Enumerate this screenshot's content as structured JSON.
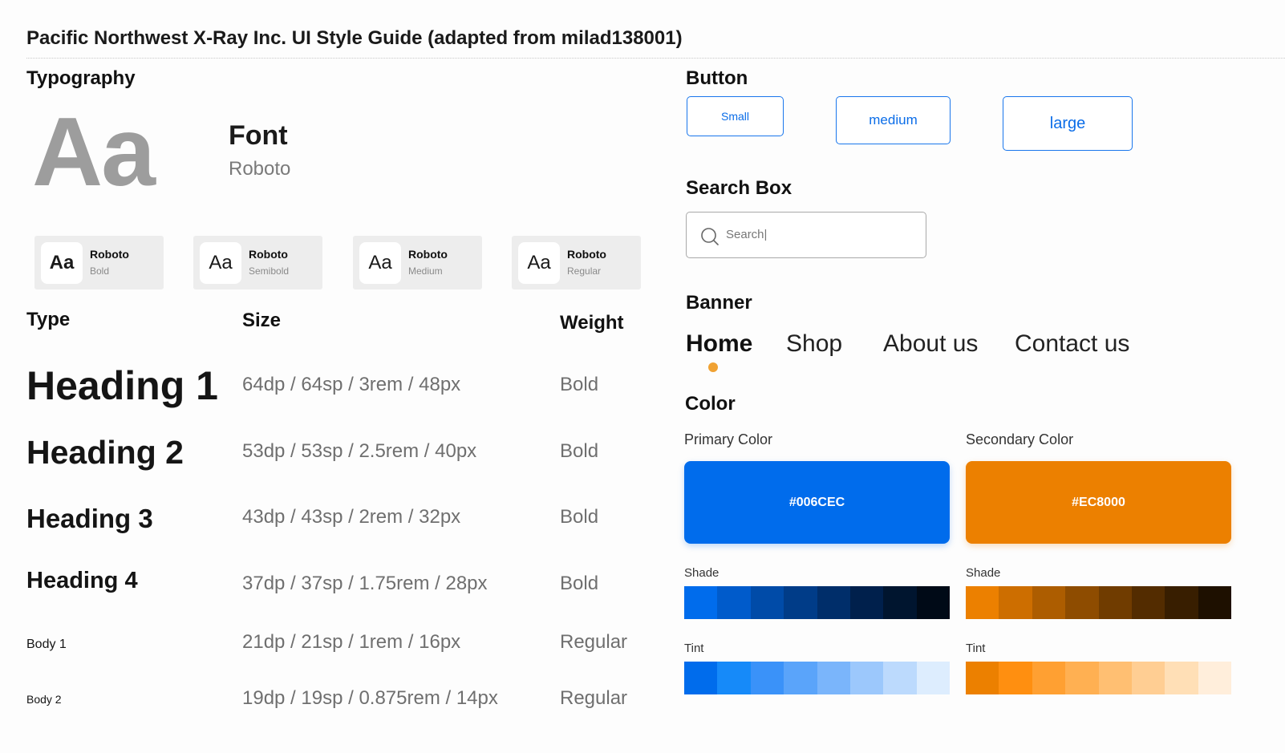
{
  "title": "Pacific Northwest X-Ray Inc. UI Style Guide (adapted from milad138001)",
  "typography": {
    "heading": "Typography",
    "sample": "Aa",
    "font_label": "Font",
    "font_name": "Roboto",
    "weights": [
      {
        "sample": "Aa",
        "family": "Roboto",
        "weight": "Bold"
      },
      {
        "sample": "Aa",
        "family": "Roboto",
        "weight": "Semibold"
      },
      {
        "sample": "Aa",
        "family": "Roboto",
        "weight": "Medium"
      },
      {
        "sample": "Aa",
        "family": "Roboto",
        "weight": "Regular"
      }
    ],
    "columns": {
      "type": "Type",
      "size": "Size",
      "weight": "Weight"
    },
    "rows": [
      {
        "type": "Heading 1",
        "size": "64dp / 64sp / 3rem / 48px",
        "weight": "Bold"
      },
      {
        "type": "Heading 2",
        "size": "53dp / 53sp / 2.5rem / 40px",
        "weight": "Bold"
      },
      {
        "type": "Heading 3",
        "size": "43dp / 43sp / 2rem / 32px",
        "weight": "Bold"
      },
      {
        "type": "Heading 4",
        "size": "37dp / 37sp / 1.75rem / 28px",
        "weight": "Bold"
      },
      {
        "type": "Body 1",
        "size": "21dp / 21sp / 1rem / 16px",
        "weight": "Regular"
      },
      {
        "type": "Body 2",
        "size": "19dp / 19sp / 0.875rem / 14px",
        "weight": "Regular"
      }
    ]
  },
  "button": {
    "heading": "Button",
    "small": "Small",
    "medium": "medium",
    "large": "large",
    "color": "#006CEC"
  },
  "search": {
    "heading": "Search Box",
    "value": "Search|",
    "icon": "search-icon"
  },
  "banner": {
    "heading": "Banner",
    "items": [
      "Home",
      "Shop",
      "About us",
      "Contact us"
    ],
    "active": "Home",
    "indicator_color": "#F0A233"
  },
  "color": {
    "heading": "Color",
    "primary": {
      "label": "Primary Color",
      "hex": "#006CEC",
      "shade_label": "Shade",
      "tint_label": "Tint",
      "shades": [
        "#006CEC",
        "#005BCB",
        "#004BA8",
        "#003C88",
        "#002E6A",
        "#00204C",
        "#00152F",
        "#000A17"
      ],
      "tints": [
        "#006CEC",
        "#168AF9",
        "#3A92F9",
        "#5AA4FA",
        "#7AB5FB",
        "#9CC8FC",
        "#BCDAFD",
        "#DDEDFE"
      ]
    },
    "secondary": {
      "label": "Secondary Color",
      "hex": "#EC8000",
      "shade_label": "Shade",
      "tint_label": "Tint",
      "shades": [
        "#EC8000",
        "#CD6E00",
        "#AD5D00",
        "#8E4C00",
        "#703C00",
        "#532C00",
        "#381E00",
        "#1E1000"
      ],
      "tints": [
        "#EC8000",
        "#FF8F10",
        "#FFA032",
        "#FFB052",
        "#FFBF72",
        "#FFCE93",
        "#FFDFB6",
        "#FFEEDB"
      ]
    }
  }
}
